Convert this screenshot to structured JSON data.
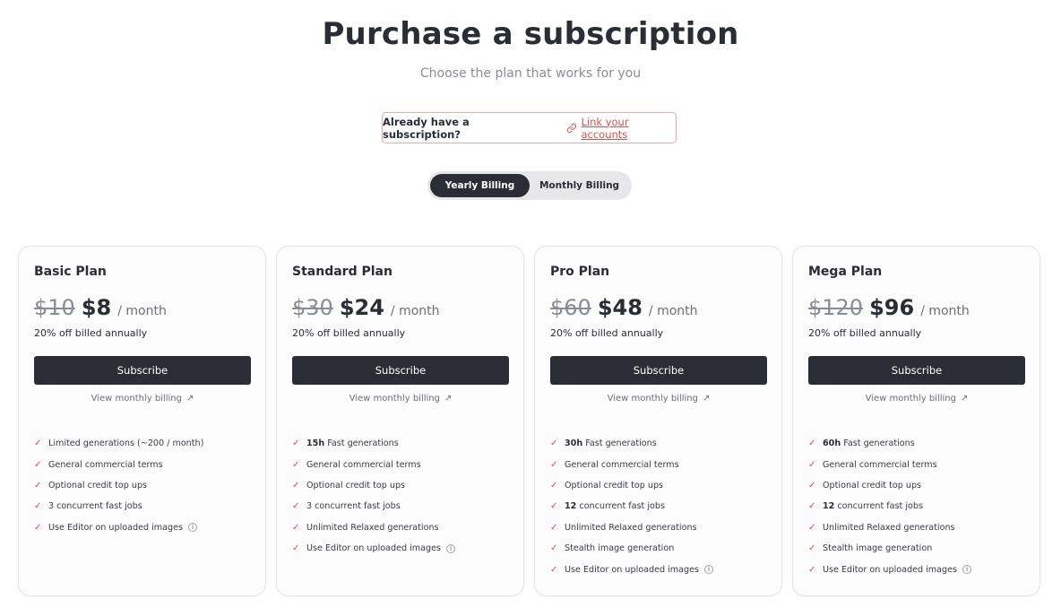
{
  "header": {
    "title": "Purchase a subscription",
    "subtitle": "Choose the plan that works for you"
  },
  "link_accounts": {
    "question": "Already have a subscription?",
    "link_label": "Link your accounts"
  },
  "billing_toggle": {
    "yearly_label": "Yearly Billing",
    "monthly_label": "Monthly Billing",
    "selected": "Yearly Billing"
  },
  "colors": {
    "accent": "#e1504a",
    "dark": "#2b2d36",
    "muted": "#8a8c94"
  },
  "plans": [
    {
      "name": "Basic Plan",
      "old_price": "$10",
      "new_price": "$8",
      "per": "/ month",
      "discount": "20% off billed annually",
      "button": "Subscribe",
      "monthly_link": "View monthly billing",
      "features": [
        {
          "bold": "",
          "text": "Limited generations (~200 / month)",
          "info": false
        },
        {
          "bold": "",
          "text": "General commercial terms",
          "info": false
        },
        {
          "bold": "",
          "text": "Optional credit top ups",
          "info": false
        },
        {
          "bold": "",
          "text": "3 concurrent fast jobs",
          "info": false
        },
        {
          "bold": "",
          "text": "Use Editor on uploaded images",
          "info": true
        }
      ]
    },
    {
      "name": "Standard Plan",
      "old_price": "$30",
      "new_price": "$24",
      "per": "/ month",
      "discount": "20% off billed annually",
      "button": "Subscribe",
      "monthly_link": "View monthly billing",
      "features": [
        {
          "bold": "15h",
          "text": " Fast generations",
          "info": false
        },
        {
          "bold": "",
          "text": "General commercial terms",
          "info": false
        },
        {
          "bold": "",
          "text": "Optional credit top ups",
          "info": false
        },
        {
          "bold": "",
          "text": "3 concurrent fast jobs",
          "info": false
        },
        {
          "bold": "",
          "text": "Unlimited Relaxed generations",
          "info": false
        },
        {
          "bold": "",
          "text": "Use Editor on uploaded images",
          "info": true
        }
      ]
    },
    {
      "name": "Pro Plan",
      "old_price": "$60",
      "new_price": "$48",
      "per": "/ month",
      "discount": "20% off billed annually",
      "button": "Subscribe",
      "monthly_link": "View monthly billing",
      "features": [
        {
          "bold": "30h",
          "text": " Fast generations",
          "info": false
        },
        {
          "bold": "",
          "text": "General commercial terms",
          "info": false
        },
        {
          "bold": "",
          "text": "Optional credit top ups",
          "info": false
        },
        {
          "bold": "12",
          "text": " concurrent fast jobs",
          "info": false
        },
        {
          "bold": "",
          "text": "Unlimited Relaxed generations",
          "info": false
        },
        {
          "bold": "",
          "text": "Stealth image generation",
          "info": false
        },
        {
          "bold": "",
          "text": "Use Editor on uploaded images",
          "info": true
        }
      ]
    },
    {
      "name": "Mega Plan",
      "old_price": "$120",
      "new_price": "$96",
      "per": "/ month",
      "discount": "20% off billed annually",
      "button": "Subscribe",
      "monthly_link": "View monthly billing",
      "features": [
        {
          "bold": "60h",
          "text": " Fast generations",
          "info": false
        },
        {
          "bold": "",
          "text": "General commercial terms",
          "info": false
        },
        {
          "bold": "",
          "text": "Optional credit top ups",
          "info": false
        },
        {
          "bold": "12",
          "text": " concurrent fast jobs",
          "info": false
        },
        {
          "bold": "",
          "text": "Unlimited Relaxed generations",
          "info": false
        },
        {
          "bold": "",
          "text": "Stealth image generation",
          "info": false
        },
        {
          "bold": "",
          "text": "Use Editor on uploaded images",
          "info": true
        }
      ]
    }
  ]
}
